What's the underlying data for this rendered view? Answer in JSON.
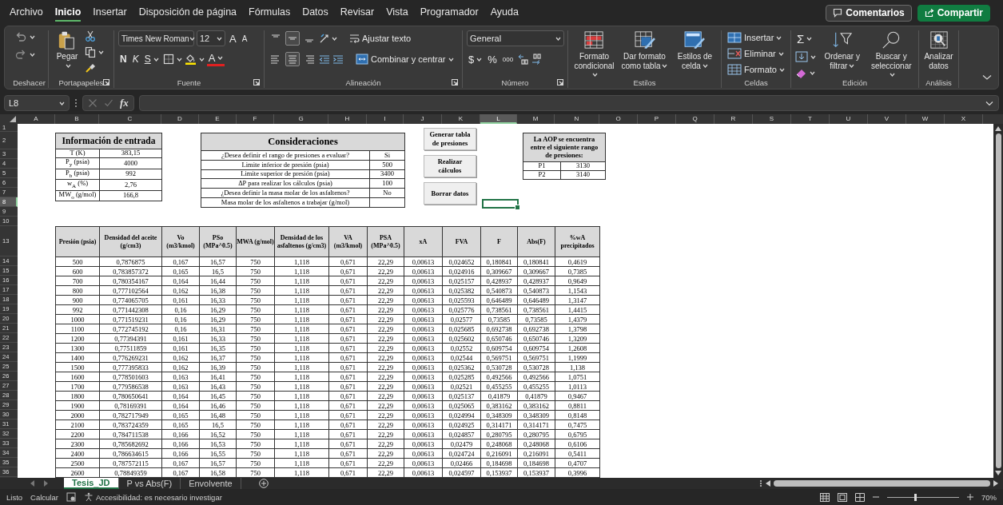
{
  "menu_tabs": [
    {
      "label": "Archivo",
      "selected": false
    },
    {
      "label": "Inicio",
      "selected": true
    },
    {
      "label": "Insertar",
      "selected": false
    },
    {
      "label": "Disposición de página",
      "selected": false
    },
    {
      "label": "Fórmulas",
      "selected": false
    },
    {
      "label": "Datos",
      "selected": false
    },
    {
      "label": "Revisar",
      "selected": false
    },
    {
      "label": "Vista",
      "selected": false
    },
    {
      "label": "Programador",
      "selected": false
    },
    {
      "label": "Ayuda",
      "selected": false
    }
  ],
  "header_buttons": [
    {
      "kind": "comments",
      "label": "Comentarios"
    },
    {
      "kind": "share",
      "label": "Compartir"
    }
  ],
  "ribbon": {
    "groups": [
      {
        "kind": "undo",
        "label": "Deshacer"
      },
      {
        "kind": "clipboard",
        "label": "Portapapeles",
        "paste": "Pegar"
      },
      {
        "kind": "font",
        "label": "Fuente",
        "font_name": "Times New Roman",
        "font_size": "12",
        "grow": "A",
        "shrink": "A",
        "bold": "N",
        "italic": "K",
        "underline": "S",
        "font_color": "A"
      },
      {
        "kind": "alignment",
        "label": "Alineación",
        "vertical": [
          {
            "selected": false
          },
          {
            "selected": true
          },
          {
            "selected": false
          }
        ],
        "horizontal": [
          {
            "selected": false
          },
          {
            "selected": true
          },
          {
            "selected": false
          }
        ],
        "wrap": "Ajustar texto",
        "merge": "Combinar y centrar"
      },
      {
        "kind": "number",
        "label": "Número",
        "format": "General",
        "currency": "$",
        "percent": "%",
        "thousands": "000"
      },
      {
        "kind": "styles",
        "label": "Estilos",
        "buttons": [
          "Formato condicional",
          "Dar formato como tabla",
          "Estilos de celda"
        ]
      },
      {
        "kind": "cells",
        "label": "Celdas",
        "buttons": [
          "Insertar",
          "Eliminar",
          "Formato"
        ]
      },
      {
        "kind": "editing",
        "label": "Edición",
        "autosum": "Σ",
        "buttons": [
          "Ordenar y filtrar",
          "Buscar y seleccionar"
        ]
      },
      {
        "kind": "analysis",
        "label": "Análisis",
        "buttons": [
          "Analizar datos"
        ]
      }
    ]
  },
  "formula_bar": {
    "name_box": "L8",
    "fx": "fx"
  },
  "column_headers": [
    {
      "label": "A",
      "selected": false
    },
    {
      "label": "B",
      "selected": false
    },
    {
      "label": "C",
      "selected": false
    },
    {
      "label": "D",
      "selected": false
    },
    {
      "label": "E",
      "selected": false
    },
    {
      "label": "F",
      "selected": false
    },
    {
      "label": "G",
      "selected": false
    },
    {
      "label": "H",
      "selected": false
    },
    {
      "label": "I",
      "selected": false
    },
    {
      "label": "J",
      "selected": false
    },
    {
      "label": "K",
      "selected": false
    },
    {
      "label": "L",
      "selected": true
    },
    {
      "label": "M",
      "selected": false
    },
    {
      "label": "N",
      "selected": false
    },
    {
      "label": "O",
      "selected": false
    },
    {
      "label": "P",
      "selected": false
    },
    {
      "label": "Q",
      "selected": false
    },
    {
      "label": "R",
      "selected": false
    },
    {
      "label": "S",
      "selected": false
    },
    {
      "label": "T",
      "selected": false
    },
    {
      "label": "U",
      "selected": false
    },
    {
      "label": "V",
      "selected": false
    },
    {
      "label": "W",
      "selected": false
    },
    {
      "label": "X",
      "selected": false
    }
  ],
  "row_headers": [
    {
      "label": "1",
      "selected": false
    },
    {
      "label": "2",
      "selected": false
    },
    {
      "label": "3",
      "selected": false
    },
    {
      "label": "4",
      "selected": false
    },
    {
      "label": "5",
      "selected": false
    },
    {
      "label": "6",
      "selected": false
    },
    {
      "label": "7",
      "selected": false
    },
    {
      "label": "8",
      "selected": true
    },
    {
      "label": "9",
      "selected": false
    },
    {
      "label": "10",
      "selected": false
    },
    {
      "label": "13",
      "selected": false
    },
    {
      "label": "14",
      "selected": false
    },
    {
      "label": "15",
      "selected": false
    },
    {
      "label": "16",
      "selected": false
    },
    {
      "label": "17",
      "selected": false
    },
    {
      "label": "18",
      "selected": false
    },
    {
      "label": "19",
      "selected": false
    },
    {
      "label": "20",
      "selected": false
    },
    {
      "label": "21",
      "selected": false
    },
    {
      "label": "22",
      "selected": false
    },
    {
      "label": "23",
      "selected": false
    },
    {
      "label": "24",
      "selected": false
    },
    {
      "label": "25",
      "selected": false
    },
    {
      "label": "26",
      "selected": false
    },
    {
      "label": "27",
      "selected": false
    },
    {
      "label": "28",
      "selected": false
    },
    {
      "label": "29",
      "selected": false
    },
    {
      "label": "30",
      "selected": false
    },
    {
      "label": "31",
      "selected": false
    },
    {
      "label": "32",
      "selected": false
    },
    {
      "label": "33",
      "selected": false
    },
    {
      "label": "34",
      "selected": false
    },
    {
      "label": "35",
      "selected": false
    },
    {
      "label": "36",
      "selected": false
    }
  ],
  "input_table": {
    "title": "Información de entrada",
    "rows": [
      {
        "label": "T (K)",
        "value": "383,15"
      },
      {
        "label": "P$_{y}$ (psia)",
        "value": "4000"
      },
      {
        "label": "P$_{b}$ (psia)",
        "value": "992"
      },
      {
        "label": "w$_{A}$ (%)",
        "value": "2,76"
      },
      {
        "label": "MW$_{o}$ (g/mol)",
        "value": "166,8"
      }
    ]
  },
  "considerations": {
    "title": "Consideraciones",
    "rows": [
      {
        "label": "¿Desea definir el rango de presiones a evaluar?",
        "value": "Si"
      },
      {
        "label": "Limite inferior de presión (psia)",
        "value": "500"
      },
      {
        "label": "Limite superior de presión (psia)",
        "value": "3400"
      },
      {
        "label": "ΔP para realizar los cálculos (psia)",
        "value": "100"
      },
      {
        "label": "¿Desea definir la masa molar de los asfaltenos?",
        "value": "No"
      },
      {
        "label": "Masa molar de los asfaltenos a trabajar (g/mol)"
      }
    ]
  },
  "action_buttons": [
    "Generar tabla de presiones",
    "Realizar cálculos",
    "Borrar datos"
  ],
  "range_table": {
    "title": "La AOP se encuentra entre el siguiente rango de presiones:",
    "rows": [
      {
        "label": "P1",
        "value": "3130"
      },
      {
        "label": "P2",
        "value": "3140"
      }
    ]
  },
  "results_table": {
    "columns": [
      "Presión (psia)",
      "Densidad del aceite (g/cm3)",
      "Vo (m3/kmol)",
      "PSo (MPa^0.5)",
      "MWA (g/mol)",
      "Densidad de los asfaltenos (g/cm3)",
      "VA (m3/kmol)",
      "PSA (MPa^0.5)",
      "xA",
      "FVA",
      "F",
      "Abs(F)",
      "%wA precipitados"
    ],
    "rows": [
      [
        "500",
        "0,7876875",
        "0,167",
        "16,57",
        "750",
        "1,118",
        "0,671",
        "22,29",
        "0,00613",
        "0,024652",
        "0,180841",
        "0,180841",
        "0,4619"
      ],
      [
        "600",
        "0,783857372",
        "0,165",
        "16,5",
        "750",
        "1,118",
        "0,671",
        "22,29",
        "0,00613",
        "0,024916",
        "0,309667",
        "0,309667",
        "0,7385"
      ],
      [
        "700",
        "0,780354167",
        "0,164",
        "16,44",
        "750",
        "1,118",
        "0,671",
        "22,29",
        "0,00613",
        "0,025157",
        "0,428937",
        "0,428937",
        "0,9649"
      ],
      [
        "800",
        "0,777102564",
        "0,162",
        "16,38",
        "750",
        "1,118",
        "0,671",
        "22,29",
        "0,00613",
        "0,025382",
        "0,540873",
        "0,540873",
        "1,1543"
      ],
      [
        "900",
        "0,774065705",
        "0,161",
        "16,33",
        "750",
        "1,118",
        "0,671",
        "22,29",
        "0,00613",
        "0,025593",
        "0,646489",
        "0,646489",
        "1,3147"
      ],
      [
        "992",
        "0,771442308",
        "0,16",
        "16,29",
        "750",
        "1,118",
        "0,671",
        "22,29",
        "0,00613",
        "0,025776",
        "0,738561",
        "0,738561",
        "1,4415"
      ],
      [
        "1000",
        "0,771519231",
        "0,16",
        "16,29",
        "750",
        "1,118",
        "0,671",
        "22,29",
        "0,00613",
        "0,02577",
        "0,73585",
        "0,73585",
        "1,4379"
      ],
      [
        "1100",
        "0,772745192",
        "0,16",
        "16,31",
        "750",
        "1,118",
        "0,671",
        "22,29",
        "0,00613",
        "0,025685",
        "0,692738",
        "0,692738",
        "1,3798"
      ],
      [
        "1200",
        "0,77394391",
        "0,161",
        "16,33",
        "750",
        "1,118",
        "0,671",
        "22,29",
        "0,00613",
        "0,025602",
        "0,650746",
        "0,650746",
        "1,3209"
      ],
      [
        "1300",
        "0,77511859",
        "0,161",
        "16,35",
        "750",
        "1,118",
        "0,671",
        "22,29",
        "0,00613",
        "0,02552",
        "0,609754",
        "0,609754",
        "1,2608"
      ],
      [
        "1400",
        "0,776269231",
        "0,162",
        "16,37",
        "750",
        "1,118",
        "0,671",
        "22,29",
        "0,00613",
        "0,02544",
        "0,569751",
        "0,569751",
        "1,1999"
      ],
      [
        "1500",
        "0,777395833",
        "0,162",
        "16,39",
        "750",
        "1,118",
        "0,671",
        "22,29",
        "0,00613",
        "0,025362",
        "0,530728",
        "0,530728",
        "1,138"
      ],
      [
        "1600",
        "0,778501603",
        "0,163",
        "16,41",
        "750",
        "1,118",
        "0,671",
        "22,29",
        "0,00613",
        "0,025285",
        "0,492566",
        "0,492566",
        "1,0751"
      ],
      [
        "1700",
        "0,779586538",
        "0,163",
        "16,43",
        "750",
        "1,118",
        "0,671",
        "22,29",
        "0,00613",
        "0,02521",
        "0,455255",
        "0,455255",
        "1,0113"
      ],
      [
        "1800",
        "0,780650641",
        "0,164",
        "16,45",
        "750",
        "1,118",
        "0,671",
        "22,29",
        "0,00613",
        "0,025137",
        "0,41879",
        "0,41879",
        "0,9467"
      ],
      [
        "1900",
        "0,78169391",
        "0,164",
        "16,46",
        "750",
        "1,118",
        "0,671",
        "22,29",
        "0,00613",
        "0,025065",
        "0,383162",
        "0,383162",
        "0,8811"
      ],
      [
        "2000",
        "0,782717949",
        "0,165",
        "16,48",
        "750",
        "1,118",
        "0,671",
        "22,29",
        "0,00613",
        "0,024994",
        "0,348309",
        "0,348309",
        "0,8148"
      ],
      [
        "2100",
        "0,783724359",
        "0,165",
        "16,5",
        "750",
        "1,118",
        "0,671",
        "22,29",
        "0,00613",
        "0,024925",
        "0,314171",
        "0,314171",
        "0,7475"
      ],
      [
        "2200",
        "0,784711538",
        "0,166",
        "16,52",
        "750",
        "1,118",
        "0,671",
        "22,29",
        "0,00613",
        "0,024857",
        "0,280795",
        "0,280795",
        "0,6795"
      ],
      [
        "2300",
        "0,785682692",
        "0,166",
        "16,53",
        "750",
        "1,118",
        "0,671",
        "22,29",
        "0,00613",
        "0,02479",
        "0,248068",
        "0,248068",
        "0,6106"
      ],
      [
        "2400",
        "0,786634615",
        "0,166",
        "16,55",
        "750",
        "1,118",
        "0,671",
        "22,29",
        "0,00613",
        "0,024724",
        "0,216091",
        "0,216091",
        "0,5411"
      ],
      [
        "2500",
        "0,787572115",
        "0,167",
        "16,57",
        "750",
        "1,118",
        "0,671",
        "22,29",
        "0,00613",
        "0,02466",
        "0,184698",
        "0,184698",
        "0,4707"
      ],
      [
        "2600",
        "0,78849359",
        "0,167",
        "16,58",
        "750",
        "1,118",
        "0,671",
        "22,29",
        "0,00613",
        "0,024597",
        "0,153937",
        "0,153937",
        "0,3996"
      ]
    ]
  },
  "sheet_tabs": [
    {
      "label": "Tesis_JD",
      "selected": true
    },
    {
      "label": "P vs Abs(F)",
      "selected": false
    },
    {
      "label": "Envolvente",
      "selected": false
    }
  ],
  "status_bar": {
    "items": [
      "Listo",
      "Calcular"
    ],
    "accessibility": "Accesibilidad: es necesario investigar",
    "zoom": {
      "level": 0.39,
      "reading": "70%"
    }
  }
}
